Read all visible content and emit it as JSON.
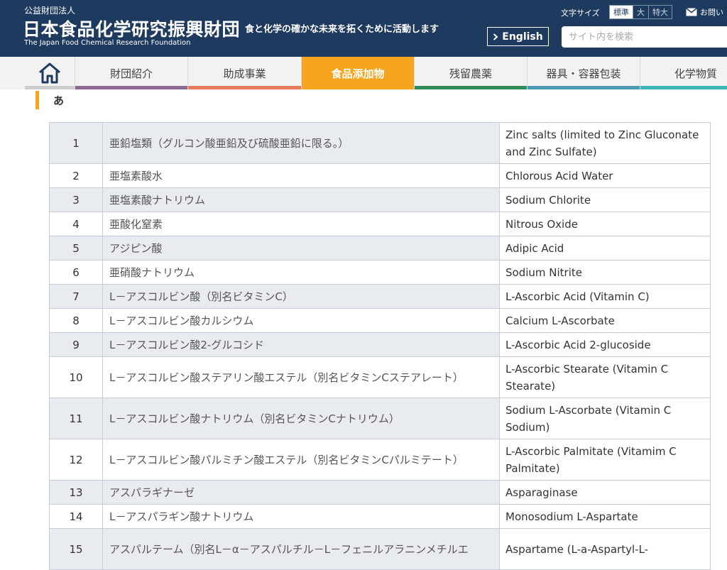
{
  "header": {
    "org_type": "公益財団法人",
    "org_name": "日本食品化学研究振興財団",
    "org_name_en": "The Japan Food Chemical Research Foundation",
    "tagline": "食と化学の確かな未来を拓くために活動します",
    "text_size_label": "文字サイズ",
    "text_size_options": [
      "標準",
      "大",
      "特大"
    ],
    "contact_label": "お問い",
    "english_label": "English",
    "search_placeholder": "サイト内を検索",
    "bg_color": "#1e3a5f"
  },
  "nav": {
    "home_icon": "home-icon",
    "items": [
      {
        "label": "財団紹介",
        "color": "#8b6a8f"
      },
      {
        "label": "助成事業",
        "color": "#e87b5a"
      },
      {
        "label": "食品添加物",
        "color": "#f7a51f",
        "active": true
      },
      {
        "label": "残留農薬",
        "color": "#2e8b57"
      },
      {
        "label": "器具・容器包装",
        "color": "#4a9bb5"
      },
      {
        "label": "化学物質",
        "color": "#3cb8b8"
      }
    ]
  },
  "section": {
    "heading": "あ"
  },
  "rows": [
    {
      "num": "1",
      "jp": "亜鉛塩類（グルコン酸亜鉛及び硫酸亜鉛に限る。）",
      "en": "Zinc salts (limited to Zinc Gluconate and Zinc Sulfate)"
    },
    {
      "num": "2",
      "jp": "亜塩素酸水",
      "en": "Chlorous Acid Water"
    },
    {
      "num": "3",
      "jp": "亜塩素酸ナトリウム",
      "en": "Sodium Chlorite"
    },
    {
      "num": "4",
      "jp": "亜酸化窒素",
      "en": "Nitrous Oxide"
    },
    {
      "num": "5",
      "jp": "アジピン酸",
      "en": "Adipic Acid"
    },
    {
      "num": "6",
      "jp": "亜硝酸ナトリウム",
      "en": "Sodium Nitrite"
    },
    {
      "num": "7",
      "jp": "L－アスコルビン酸（別名ビタミンC）",
      "en": "L-Ascorbic Acid (Vitamin C)"
    },
    {
      "num": "8",
      "jp": "L－アスコルビン酸カルシウム",
      "en": "Calcium L-Ascorbate"
    },
    {
      "num": "9",
      "jp": "L－アスコルビン酸2-グルコシド",
      "en": "L-Ascorbic Acid 2-glucoside"
    },
    {
      "num": "10",
      "jp": "L－アスコルビン酸ステアリン酸エステル（別名ビタミンCステアレート）",
      "en": "L-Ascorbic Stearate (Vitamin C Stearate)"
    },
    {
      "num": "11",
      "jp": "L－アスコルビン酸ナトリウム（別名ビタミンCナトリウム）",
      "en": "Sodium L-Ascorbate (Vitamin C Sodium)"
    },
    {
      "num": "12",
      "jp": "L－アスコルビン酸パルミチン酸エステル（別名ビタミンCパルミテート）",
      "en": "L-Ascorbic Palmitate (Vitamim C Palmitate)"
    },
    {
      "num": "13",
      "jp": "アスパラギナーゼ",
      "en": "Asparaginase"
    },
    {
      "num": "14",
      "jp": "L－アスパラギン酸ナトリウム",
      "en": "Monosodium L-Aspartate"
    },
    {
      "num": "15",
      "jp": "アスパルテーム（別名L－α－アスパルチル－L－フェニルアラニンメチルエ",
      "en": "Aspartame (L-a-Aspartyl-L-"
    }
  ]
}
